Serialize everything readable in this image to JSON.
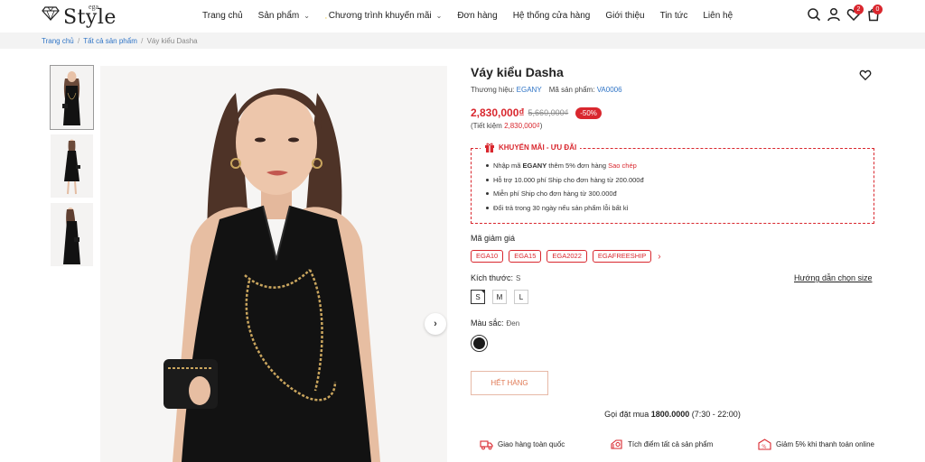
{
  "header": {
    "logo_small": "ega",
    "logo_main": "Style",
    "nav": [
      {
        "label": "Trang chủ"
      },
      {
        "label": "Sản phẩm"
      },
      {
        "label": "Chương trình khuyến mãi"
      },
      {
        "label": "Đơn hàng"
      },
      {
        "label": "Hệ thống cửa hàng"
      },
      {
        "label": "Giới thiệu"
      },
      {
        "label": "Tin tức"
      },
      {
        "label": "Liên hệ"
      }
    ],
    "wishlist_count": "2",
    "cart_count": "0"
  },
  "breadcrumb": {
    "home": "Trang chủ",
    "all": "Tất cả sản phẩm",
    "current": "Váy kiểu Dasha",
    "sep": "/"
  },
  "product": {
    "title": "Váy kiểu Dasha",
    "brand_label": "Thương hiệu:",
    "brand": "EGANY",
    "sku_label": "Mã sản phẩm:",
    "sku": "VA0006",
    "price": "2,830,000₫",
    "old_price": "5,660,000₫",
    "discount": "-50%",
    "save_prefix": "(Tiết kiệm",
    "save_amount": "2,830,000₫",
    "save_suffix": ")"
  },
  "promo": {
    "heading": "KHUYẾN MÃI - ƯU ĐÃI",
    "item1_pre": "Nhập mã",
    "item1_code": "EGANY",
    "item1_post": "thêm 5% đơn hàng",
    "item1_copy": "Sao chép",
    "item2": "Hỗ trợ 10.000 phí Ship cho đơn hàng từ 200.000đ",
    "item3": "Miễn phí Ship cho đơn hàng từ 300.000đ",
    "item4": "Đổi trả trong 30 ngày nếu sản phẩm lỗi bất kì"
  },
  "coupons": {
    "label": "Mã giảm giá",
    "codes": [
      "EGA10",
      "EGA15",
      "EGA2022",
      "EGAFREESHIP"
    ]
  },
  "size": {
    "label": "Kích thước:",
    "selected": "S",
    "options": [
      "S",
      "M",
      "L"
    ],
    "guide": "Hướng dẫn chọn size"
  },
  "color": {
    "label": "Màu sắc:",
    "selected": "Đen",
    "swatch_hex": "#1a1a1a"
  },
  "actions": {
    "sold_out": "HẾT HÀNG",
    "hotline_pre": "Gọi đặt mua",
    "hotline_number": "1800.0000",
    "hotline_hours": "(7:30 - 22:00)"
  },
  "features": [
    {
      "label": "Giao hàng toàn quốc",
      "icon": "truck-icon"
    },
    {
      "label": "Tích điểm tất cả sản phẩm",
      "icon": "points-icon"
    },
    {
      "label": "Giảm 5% khi thanh toán online",
      "icon": "discount-icon"
    }
  ],
  "colors": {
    "accent": "#d9272e",
    "link": "#2f74c6"
  }
}
